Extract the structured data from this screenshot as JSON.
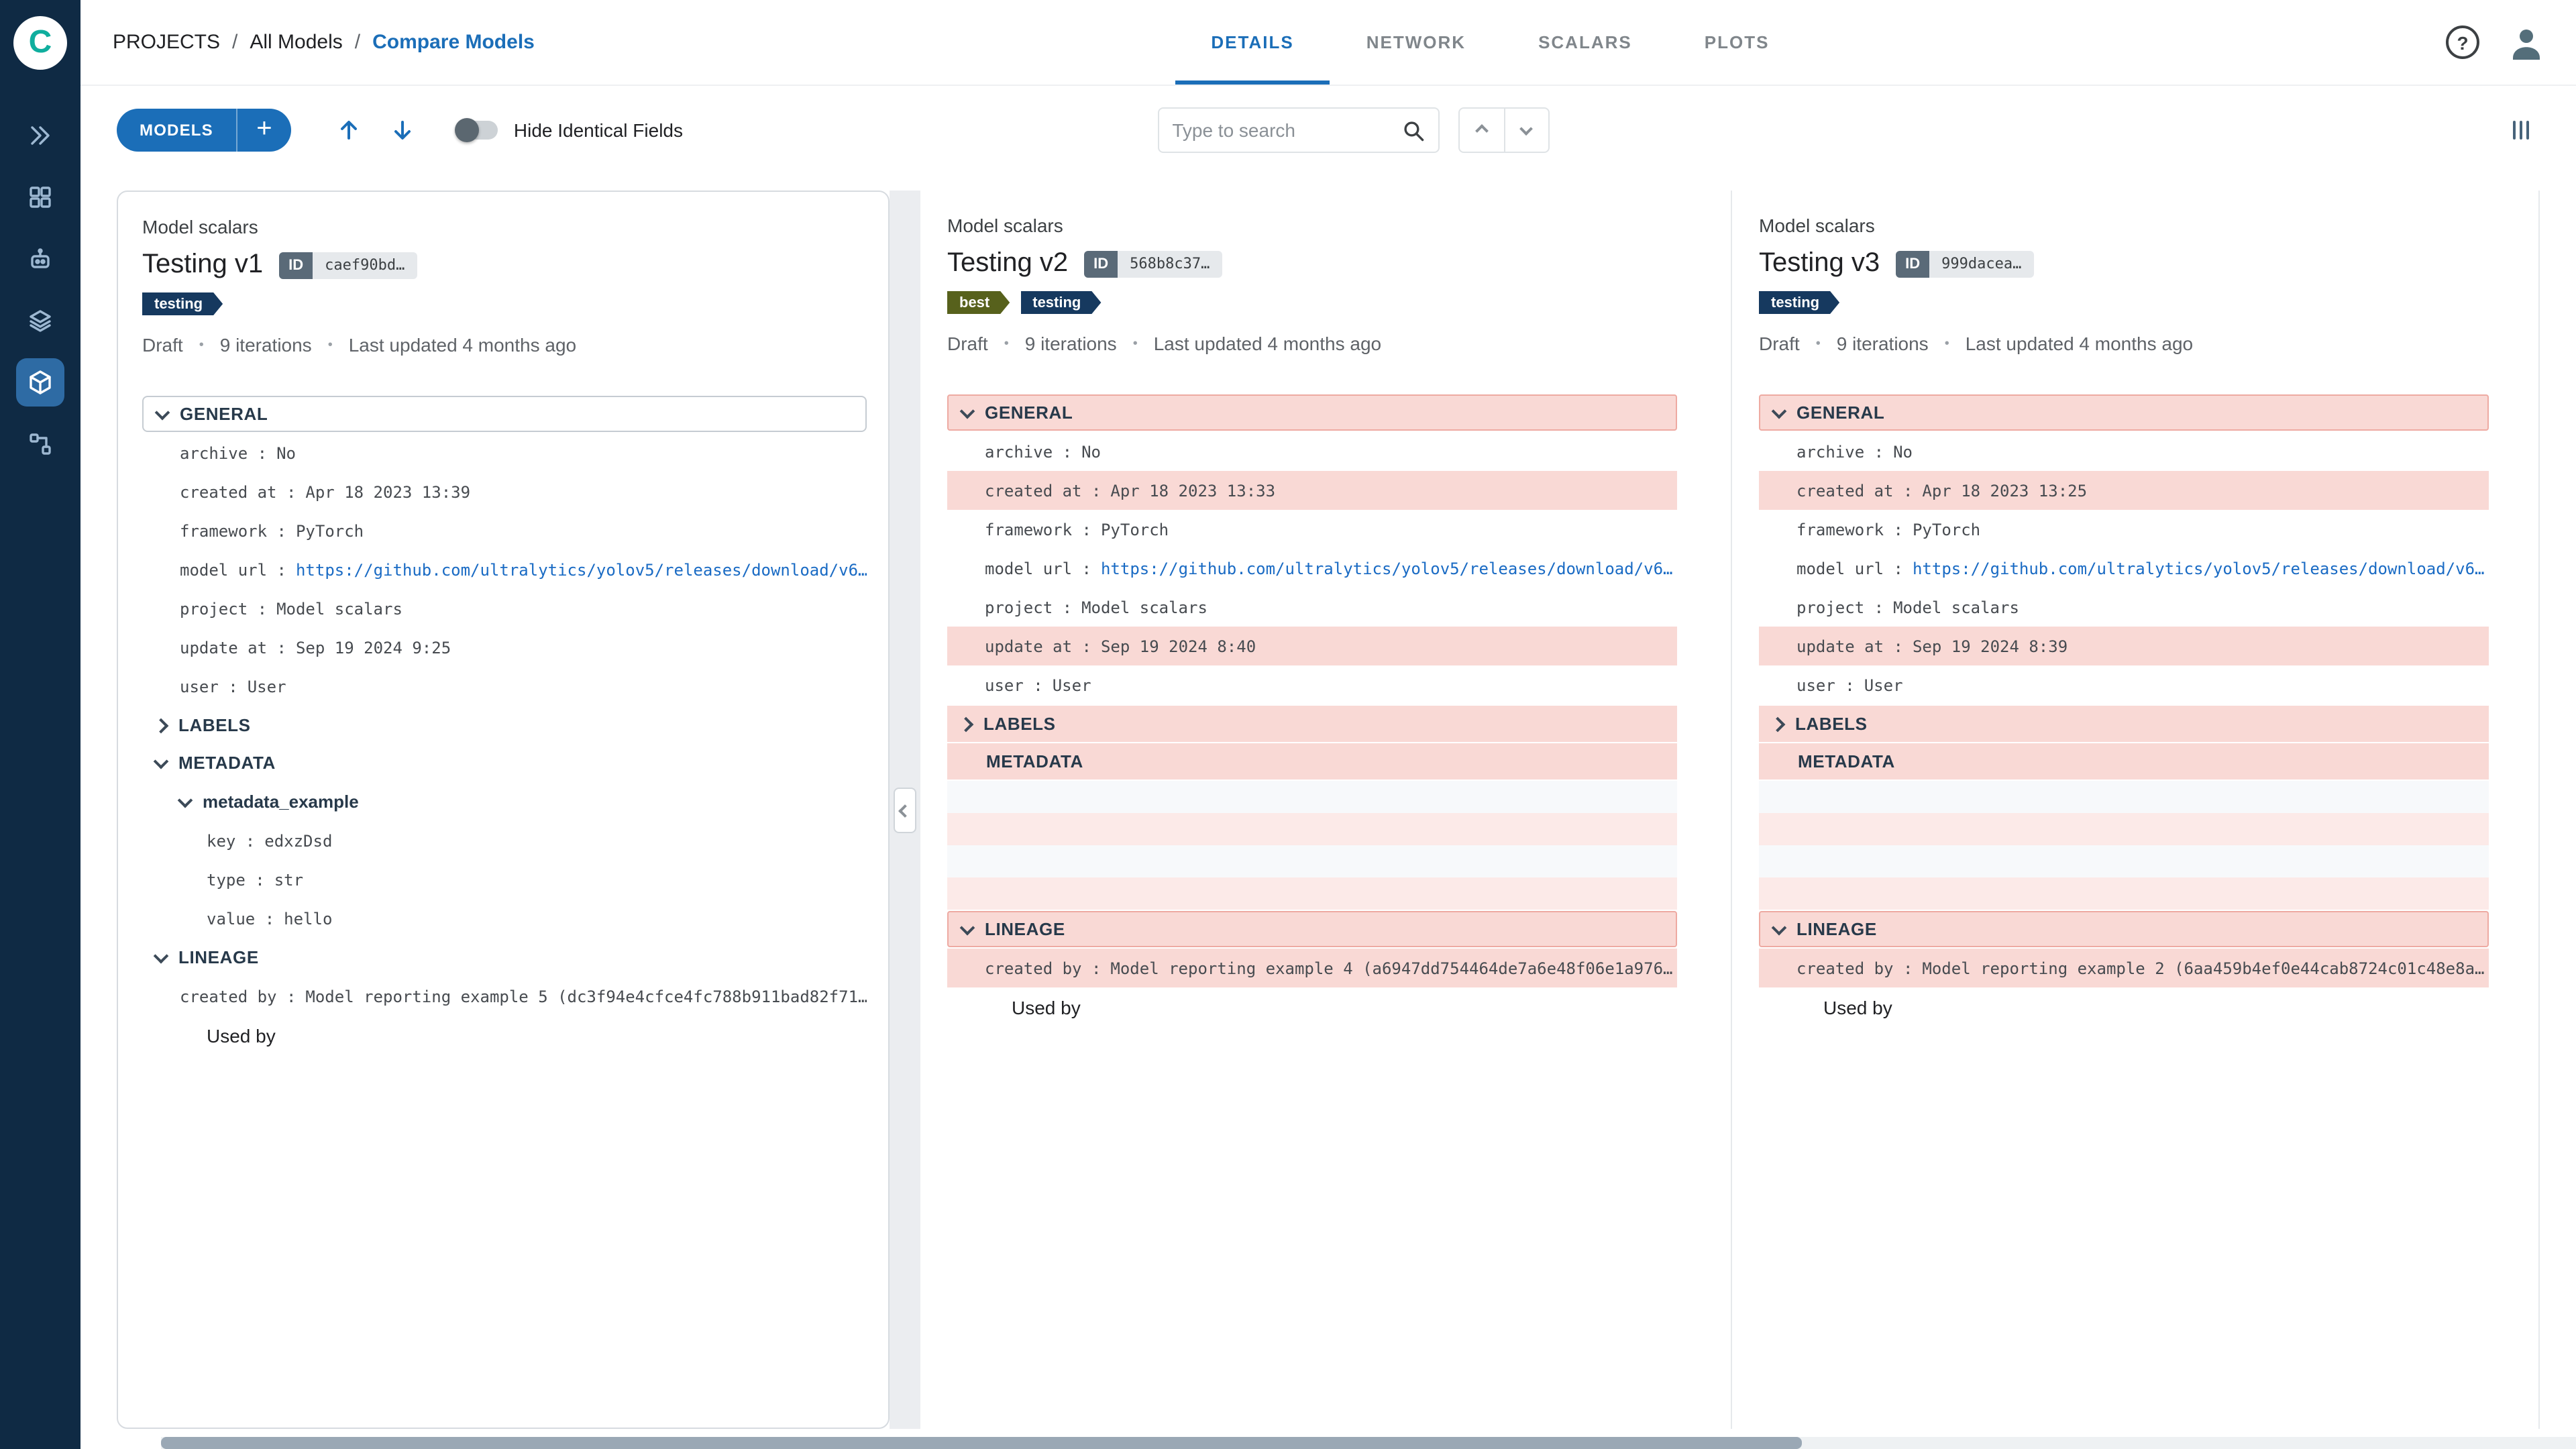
{
  "app": {
    "logo_text": "C",
    "dot": "•",
    "breadcrumb": {
      "separator": "/",
      "items": [
        "PROJECTS",
        "All Models",
        "Compare Models"
      ]
    },
    "tabs": [
      "DETAILS",
      "NETWORK",
      "SCALARS",
      "PLOTS"
    ],
    "active_tab": "DETAILS",
    "header_icons": {
      "help": "?"
    }
  },
  "toolbar": {
    "models_button": "MODELS",
    "add_button": "+",
    "toggle_label": "Hide Identical Fields",
    "toggle_on": false,
    "search_placeholder": "Type to search"
  },
  "colors": {
    "accent_blue": "#1b6eb8",
    "link_blue": "#1a6bc4",
    "sidebar_bg": "#0f2a44",
    "diff_bg": "#f9d9d5",
    "diff_border": "#eeaaa2",
    "tag_testing": "#16395f",
    "tag_best": "#57611c"
  },
  "panels": [
    {
      "subtitle": "Model scalars",
      "title": "Testing v1",
      "id_label": "ID",
      "id_value": "caef90bd…",
      "tags": [
        "testing"
      ],
      "status": {
        "state": "Draft",
        "iterations": "9 iterations",
        "updated": "Last updated 4 months ago"
      },
      "sections": {
        "general": {
          "label": "GENERAL",
          "rows": [
            {
              "key": "archive :",
              "value": "No"
            },
            {
              "key": "created at :",
              "value": "Apr 18 2023 13:39"
            },
            {
              "key": "framework :",
              "value": "PyTorch"
            },
            {
              "key": "model url :",
              "value": "https://github.com/ultralytics/yolov5/releases/download/v6…"
            },
            {
              "key": "project :",
              "value": "Model scalars"
            },
            {
              "key": "update at :",
              "value": "Sep 19 2024 9:25"
            },
            {
              "key": "user :",
              "value": "User"
            }
          ]
        },
        "labels": {
          "label": "LABELS"
        },
        "metadata": {
          "label": "METADATA",
          "group": "metadata_example",
          "rows": [
            {
              "key": "key :",
              "value": "edxzDsd"
            },
            {
              "key": "type :",
              "value": "str"
            },
            {
              "key": "value :",
              "value": "hello"
            }
          ]
        },
        "lineage": {
          "label": "LINEAGE",
          "rows": [
            {
              "key": "created by :",
              "value": "Model reporting example 5 (dc3f94e4cfce4fc788b911bad82f71…"
            }
          ],
          "used_by": "Used by"
        }
      }
    },
    {
      "subtitle": "Model scalars",
      "title": "Testing v2",
      "id_label": "ID",
      "id_value": "568b8c37…",
      "tags": [
        "best",
        "testing"
      ],
      "status": {
        "state": "Draft",
        "iterations": "9 iterations",
        "updated": "Last updated 4 months ago"
      },
      "sections": {
        "general": {
          "label": "GENERAL",
          "rows": [
            {
              "key": "archive :",
              "value": "No"
            },
            {
              "key": "created at :",
              "value": "Apr 18 2023 13:33"
            },
            {
              "key": "framework :",
              "value": "PyTorch"
            },
            {
              "key": "model url :",
              "value": "https://github.com/ultralytics/yolov5/releases/download/v6…"
            },
            {
              "key": "project :",
              "value": "Model scalars"
            },
            {
              "key": "update at :",
              "value": "Sep 19 2024 8:40"
            },
            {
              "key": "user :",
              "value": "User"
            }
          ]
        },
        "labels": {
          "label": "LABELS"
        },
        "metadata": {
          "label": "METADATA"
        },
        "lineage": {
          "label": "LINEAGE",
          "rows": [
            {
              "key": "created by :",
              "value": "Model reporting example 4 (a6947dd754464de7a6e48f06e1a976…"
            }
          ],
          "used_by": "Used by"
        }
      }
    },
    {
      "subtitle": "Model scalars",
      "title": "Testing v3",
      "id_label": "ID",
      "id_value": "999dacea…",
      "tags": [
        "testing"
      ],
      "status": {
        "state": "Draft",
        "iterations": "9 iterations",
        "updated": "Last updated 4 months ago"
      },
      "sections": {
        "general": {
          "label": "GENERAL",
          "rows": [
            {
              "key": "archive :",
              "value": "No"
            },
            {
              "key": "created at :",
              "value": "Apr 18 2023 13:25"
            },
            {
              "key": "framework :",
              "value": "PyTorch"
            },
            {
              "key": "model url :",
              "value": "https://github.com/ultralytics/yolov5/releases/download/v6…"
            },
            {
              "key": "project :",
              "value": "Model scalars"
            },
            {
              "key": "update at :",
              "value": "Sep 19 2024 8:39"
            },
            {
              "key": "user :",
              "value": "User"
            }
          ]
        },
        "labels": {
          "label": "LABELS"
        },
        "metadata": {
          "label": "METADATA"
        },
        "lineage": {
          "label": "LINEAGE",
          "rows": [
            {
              "key": "created by :",
              "value": "Model reporting example 2 (6aa459b4ef0e44cab8724c01c48e8a…"
            }
          ],
          "used_by": "Used by"
        }
      }
    }
  ]
}
